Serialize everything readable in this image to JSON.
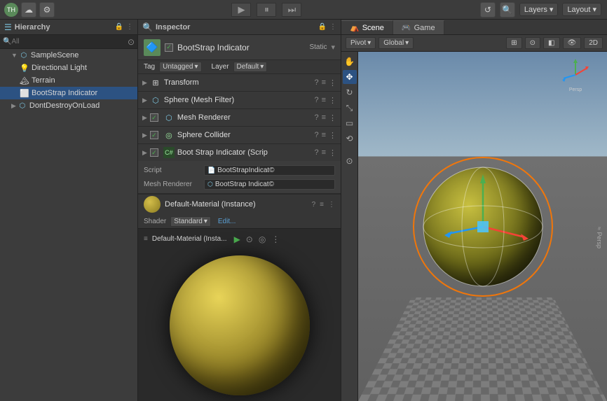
{
  "topbar": {
    "account": "TH",
    "layers_label": "Layers",
    "layout_label": "Layout"
  },
  "hierarchy": {
    "title": "Hierarchy",
    "search_placeholder": "All",
    "items": [
      {
        "label": "SampleScene",
        "level": 0,
        "type": "scene",
        "has_arrow": true
      },
      {
        "label": "Directional Light",
        "level": 1,
        "type": "light"
      },
      {
        "label": "Terrain",
        "level": 1,
        "type": "terrain"
      },
      {
        "label": "BootStrap Indicator",
        "level": 1,
        "type": "object",
        "selected": true
      },
      {
        "label": "DontDestroyOnLoad",
        "level": 0,
        "type": "scene",
        "has_arrow": true
      }
    ]
  },
  "inspector": {
    "title": "Inspector",
    "object_name": "BootStrap Indicator",
    "static_label": "Static",
    "tag_label": "Tag",
    "tag_value": "Untagged",
    "layer_label": "Layer",
    "layer_value": "Default",
    "components": [
      {
        "name": "Transform",
        "icon": "⊞",
        "enabled": true
      },
      {
        "name": "Sphere (Mesh Filter)",
        "icon": "⬡",
        "enabled": true
      },
      {
        "name": "Mesh Renderer",
        "icon": "⬡",
        "enabled": true
      },
      {
        "name": "Sphere Collider",
        "icon": "◎",
        "enabled": true
      },
      {
        "name": "Boot Strap Indicator (Scrip",
        "icon": "✦",
        "enabled": true
      }
    ],
    "script_label": "Script",
    "script_value": "BootStrapIndicat©",
    "mesh_renderer_label": "Mesh Renderer",
    "mesh_renderer_value": "BootStrap Indicat©",
    "material": {
      "name": "Default-Material (Instance)",
      "shader_label": "Shader",
      "shader_value": "Standard",
      "edit_label": "Edit...",
      "bottom_label": "Default-Material (Insta..."
    }
  },
  "scene": {
    "scene_tab": "Scene",
    "game_tab": "Game",
    "pivot_label": "Pivot",
    "global_label": "Global",
    "persp_label": "≈ Persp"
  },
  "icons": {
    "play": "▶",
    "pause": "⏸",
    "step": "⏭",
    "search": "🔍",
    "gear": "⚙",
    "refresh": "↺",
    "arrow_right": "▶",
    "arrow_down": "▼",
    "question": "?",
    "settings": "≡",
    "more": "⋮",
    "hand": "✋",
    "move": "✥",
    "rotate": "↻",
    "scale": "⤡",
    "rect": "▭",
    "transform": "⟲",
    "chevron": "▾"
  }
}
